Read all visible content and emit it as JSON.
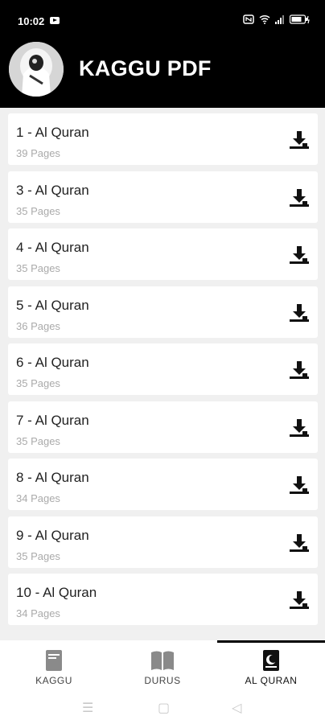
{
  "status": {
    "time": "10:02",
    "icons": [
      "youtube-icon",
      "nfc-icon",
      "wifi-icon",
      "signal-icon",
      "battery-icon"
    ]
  },
  "header": {
    "title": "KAGGU PDF",
    "avatar": "profile-avatar"
  },
  "items": [
    {
      "title": "1 - Al Quran",
      "pages": "39 Pages"
    },
    {
      "title": "3 - Al Quran",
      "pages": "35 Pages"
    },
    {
      "title": "4 - Al Quran",
      "pages": "35 Pages"
    },
    {
      "title": "5 - Al Quran",
      "pages": "36 Pages"
    },
    {
      "title": "6 - Al Quran",
      "pages": "35 Pages"
    },
    {
      "title": "7 - Al Quran",
      "pages": "35 Pages"
    },
    {
      "title": "8 - Al Quran",
      "pages": "34 Pages"
    },
    {
      "title": "9 - Al Quran",
      "pages": "35 Pages"
    },
    {
      "title": "10 - Al Quran",
      "pages": "34 Pages"
    }
  ],
  "nav": {
    "tabs": [
      {
        "label": "KAGGU",
        "icon": "book-icon"
      },
      {
        "label": "DURUS",
        "icon": "open-book-icon"
      },
      {
        "label": "AL QURAN",
        "icon": "quran-icon"
      }
    ],
    "active": "AL QURAN"
  },
  "colors": {
    "header_bg": "#000000",
    "list_bg": "#f0f0f0",
    "card_bg": "#ffffff",
    "subtitle": "#aaaaaa"
  }
}
